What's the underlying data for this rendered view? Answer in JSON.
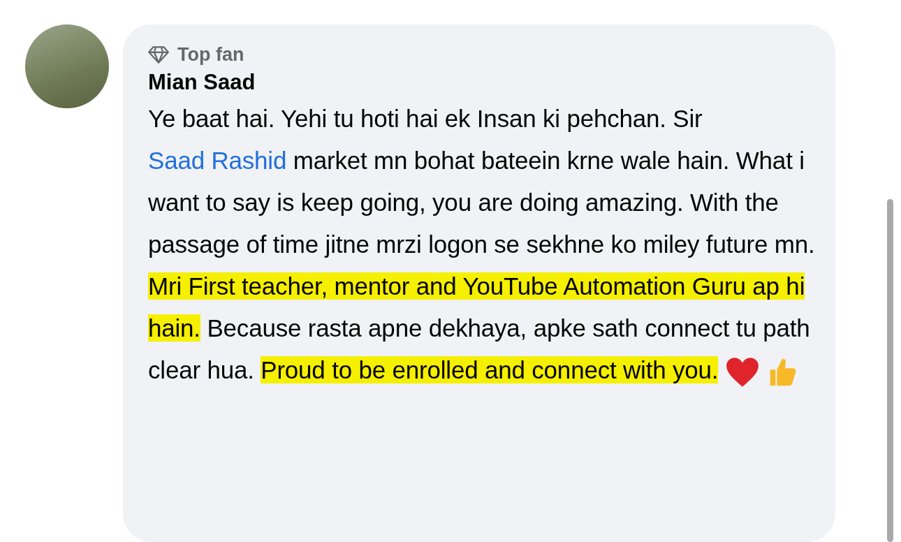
{
  "comment": {
    "badge": "Top fan",
    "author": "Mian Saad",
    "segments": [
      {
        "kind": "text",
        "text": "Ye baat hai. Yehi tu hoti hai ek Insan ki pehchan. Sir "
      },
      {
        "kind": "link",
        "text": "Saad Rashid"
      },
      {
        "kind": "text",
        "text": " market mn bohat bateein krne wale hain. What i want to say is keep going, you are doing amazing. With the passage of time jitne mrzi logon se sekhne ko miley future mn. "
      },
      {
        "kind": "highlight",
        "text": "Mri First teacher, mentor and YouTube Automation Guru ap hi hain."
      },
      {
        "kind": "text",
        "text": " Because rasta apne dekhaya, apke sath connect tu path clear hua. "
      },
      {
        "kind": "highlight",
        "text": "Proud to be enrolled and connect with you."
      },
      {
        "kind": "heart"
      },
      {
        "kind": "thumbs_up"
      }
    ]
  }
}
